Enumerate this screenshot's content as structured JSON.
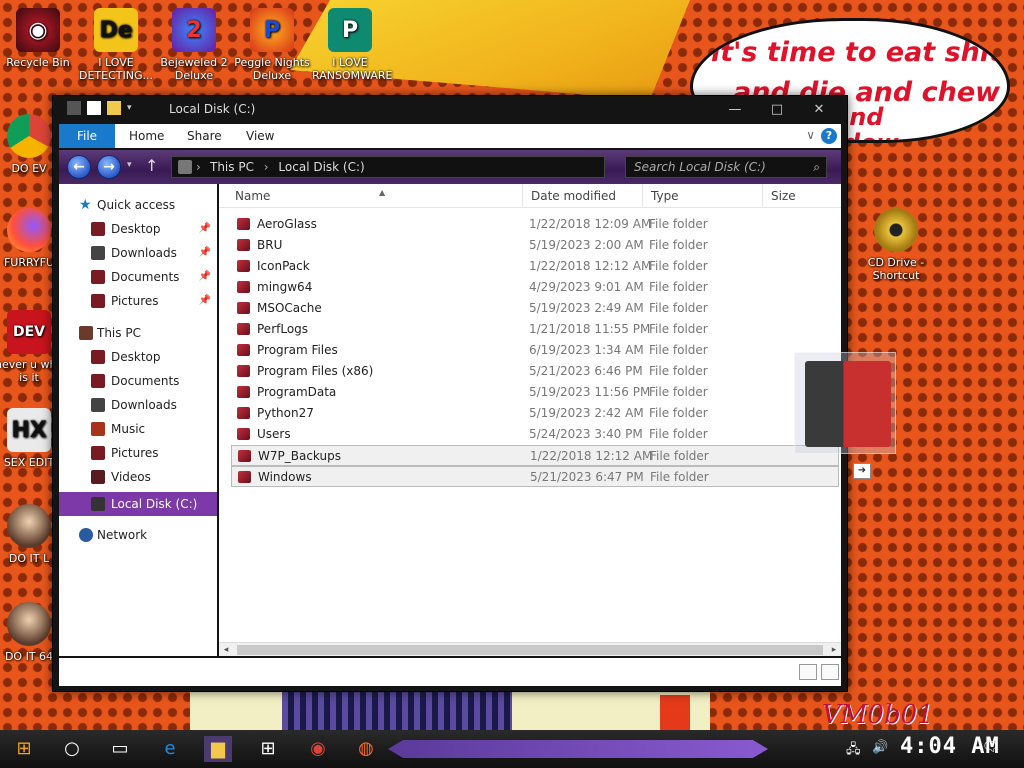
{
  "wallpaper": {
    "speech_lines": [
      "it's time to eat shit",
      "and die and chew",
      "and",
      "dew"
    ],
    "watermark": "VM0b01"
  },
  "desktop_icons": [
    {
      "label": "Recycle Bin",
      "icon": "recycle-bin-icon"
    },
    {
      "label": "I LOVE DETECTING...",
      "icon": "detect-it-easy-icon"
    },
    {
      "label": "Bejeweled 2 Deluxe",
      "icon": "bejeweled-icon"
    },
    {
      "label": "Peggle Nights Deluxe",
      "icon": "peggle-icon"
    },
    {
      "label": "I LOVE RANSOMWARE",
      "icon": "publisher-icon"
    },
    {
      "label": "DO EV",
      "icon": "chrome-icon"
    },
    {
      "label": "FURRYFU",
      "icon": "firefox-icon"
    },
    {
      "label": "never u why is it",
      "icon": "dev-cpp-icon"
    },
    {
      "label": "SEX EDIT",
      "icon": "hex-editor-icon"
    },
    {
      "label": "DO IT L",
      "icon": "portrait-icon"
    },
    {
      "label": "DO IT 64",
      "icon": "portrait-icon"
    },
    {
      "label": "CD Drive - Shortcut",
      "icon": "cd-drive-icon"
    }
  ],
  "window": {
    "title": "Local Disk (C:)",
    "controls": {
      "minimize": "—",
      "maximize": "□",
      "close": "✕"
    }
  },
  "ribbon": {
    "tabs": [
      "File",
      "Home",
      "Share",
      "View"
    ],
    "expand": "∨",
    "help": "?"
  },
  "address": {
    "crumbs": [
      "This PC",
      "Local Disk (C:)"
    ],
    "search_placeholder": "Search Local Disk (C:)"
  },
  "nav": {
    "quick_access": "Quick access",
    "quick_items": [
      "Desktop",
      "Downloads",
      "Documents",
      "Pictures"
    ],
    "this_pc": "This PC",
    "pc_items": [
      "Desktop",
      "Documents",
      "Downloads",
      "Music",
      "Pictures",
      "Videos"
    ],
    "local_disk": "Local Disk (C:)",
    "network": "Network"
  },
  "columns": [
    "Name",
    "Date modified",
    "Type",
    "Size"
  ],
  "files": [
    {
      "name": "AeroGlass",
      "date": "1/22/2018 12:09 AM",
      "type": "File folder"
    },
    {
      "name": "BRU",
      "date": "5/19/2023 2:00 AM",
      "type": "File folder"
    },
    {
      "name": "IconPack",
      "date": "1/22/2018 12:12 AM",
      "type": "File folder"
    },
    {
      "name": "mingw64",
      "date": "4/29/2023 9:01 AM",
      "type": "File folder"
    },
    {
      "name": "MSOCache",
      "date": "5/19/2023 2:49 AM",
      "type": "File folder"
    },
    {
      "name": "PerfLogs",
      "date": "1/21/2018 11:55 PM",
      "type": "File folder"
    },
    {
      "name": "Program Files",
      "date": "6/19/2023 1:34 AM",
      "type": "File folder"
    },
    {
      "name": "Program Files (x86)",
      "date": "5/21/2023 6:46 PM",
      "type": "File folder"
    },
    {
      "name": "ProgramData",
      "date": "5/19/2023 11:56 PM",
      "type": "File folder"
    },
    {
      "name": "Python27",
      "date": "5/19/2023 2:42 AM",
      "type": "File folder"
    },
    {
      "name": "Users",
      "date": "5/24/2023 3:40 PM",
      "type": "File folder"
    },
    {
      "name": "W7P_Backups",
      "date": "1/22/2018 12:12 AM",
      "type": "File folder"
    },
    {
      "name": "Windows",
      "date": "5/21/2023 6:47 PM",
      "type": "File folder"
    }
  ],
  "taskbar": {
    "clock": "4:04 AM"
  },
  "colors": {
    "accent": "#1979ca",
    "selection": "#7b3aa8"
  }
}
